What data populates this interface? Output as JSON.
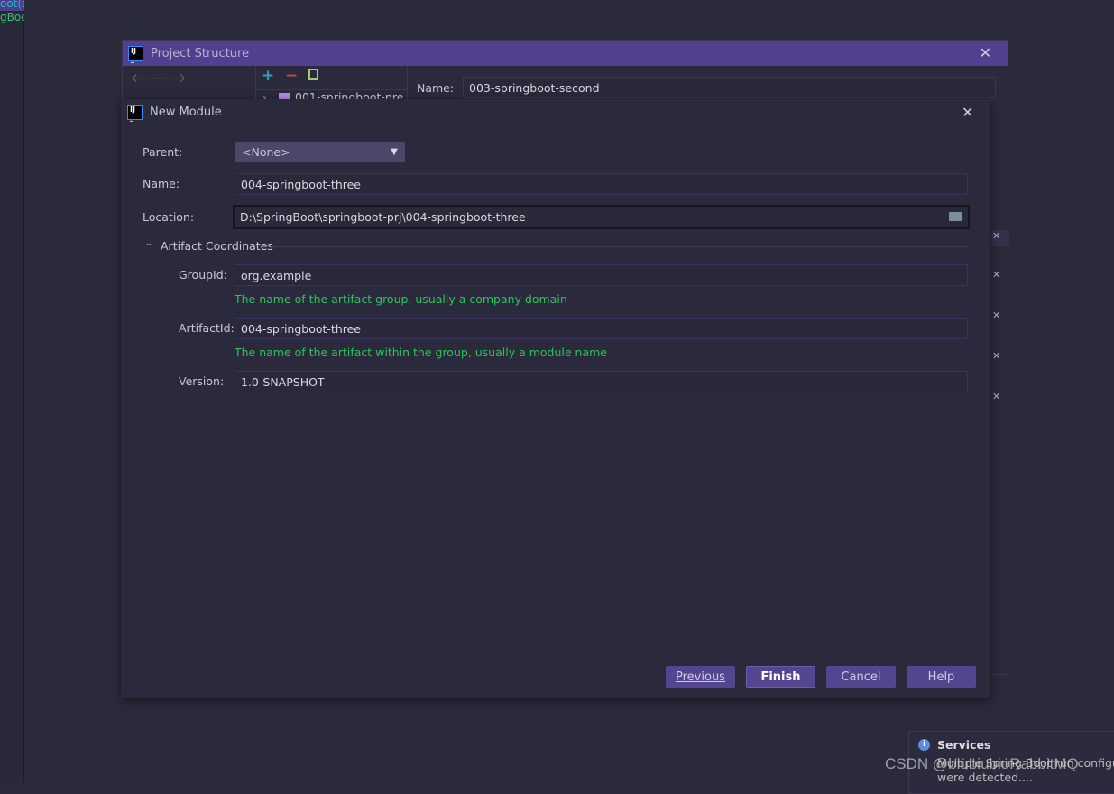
{
  "ide": {
    "lines": [
      "oot(s",
      "gBoo"
    ]
  },
  "project_structure": {
    "title": "Project Structure",
    "name_label": "Name:",
    "name_value": "003-springboot-second",
    "tree_item": "001-springboot-pre"
  },
  "new_module": {
    "title": "New Module",
    "parent": {
      "label": "Parent:",
      "value": "<None>"
    },
    "name": {
      "label": "Name:",
      "value": "004-springboot-three"
    },
    "location": {
      "label": "Location:",
      "value": "D:\\SpringBoot\\springboot-prj\\004-springboot-three"
    },
    "artifact_section": "Artifact Coordinates",
    "group_id": {
      "label": "GroupId:",
      "value": "org.example",
      "hint": "The name of the artifact group, usually a company domain"
    },
    "artifact_id": {
      "label": "ArtifactId:",
      "value": "004-springboot-three",
      "hint": "The name of the artifact within the group, usually a module name"
    },
    "version": {
      "label": "Version:",
      "value": "1.0-SNAPSHOT"
    },
    "buttons": {
      "previous": "Previous",
      "finish": "Finish",
      "cancel": "Cancel",
      "help": "Help"
    }
  },
  "notification": {
    "title": "Services",
    "body_line1": "Multiple Spring Boot run configurations",
    "body_line2": "were detected...."
  },
  "watermark": "CSDN @biubiubiuRabbitMQ",
  "colors": {
    "accent": "#523f8f",
    "hint": "#2bc45a",
    "button": "#534590"
  }
}
